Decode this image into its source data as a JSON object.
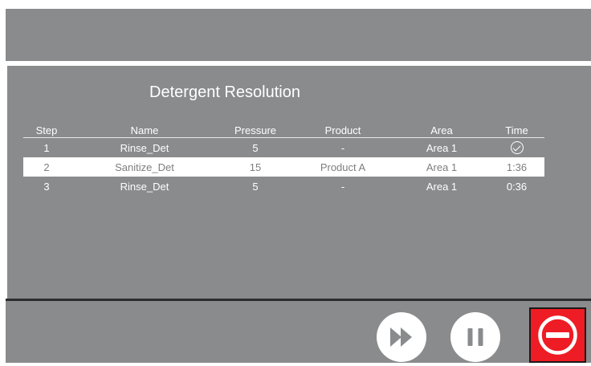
{
  "title": "Detergent Resolution",
  "table": {
    "headers": [
      "Step",
      "Name",
      "Pressure",
      "Product",
      "Area",
      "Time"
    ],
    "rows": [
      {
        "step": "1",
        "name": "Rinse_Det",
        "pressure": "5",
        "product": "-",
        "area": "Area 1",
        "time": "",
        "time_icon": "checkmark-circle-icon"
      },
      {
        "step": "2",
        "name": "Sanitize_Det",
        "pressure": "15",
        "product": "Product A",
        "area": "Area 1",
        "time": "1:36"
      },
      {
        "step": "3",
        "name": "Rinse_Det",
        "pressure": "5",
        "product": "-",
        "area": "Area 1",
        "time": "0:36"
      }
    ],
    "selected_row": 2
  },
  "controls": {
    "skip_icon": "fast-forward-icon",
    "pause_icon": "pause-icon",
    "stop_icon": "stop-icon"
  },
  "colors": {
    "panel": "#8a8b8d",
    "selected_row_bg": "#ffffff",
    "stop_red": "#ee1c24"
  }
}
